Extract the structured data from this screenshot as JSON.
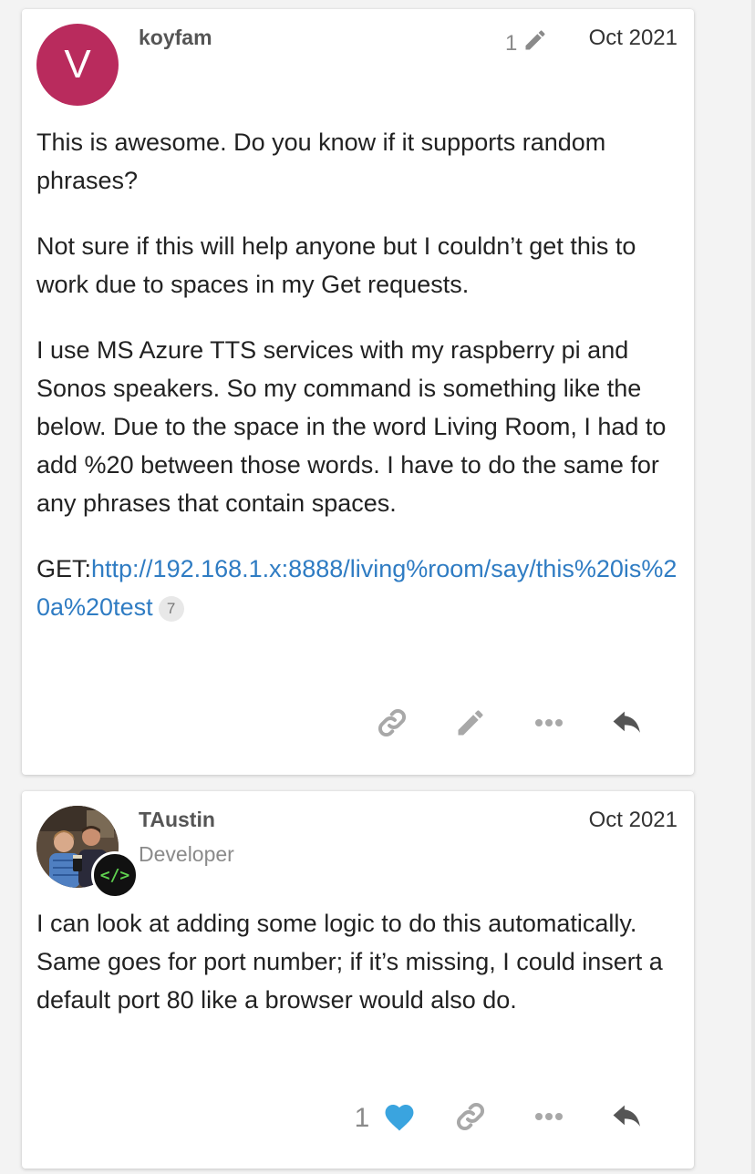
{
  "posts": [
    {
      "avatar_letter": "V",
      "avatar_color": "#b92b5d",
      "username": "koyfam",
      "edit_count": "1",
      "date": "Oct 2021",
      "paragraphs": [
        "This is awesome. Do you know if it supports random phrases?",
        "Not sure if this will help anyone but I couldn’t get this to work due to spaces in my Get requests.",
        "I use MS Azure TTS services with my raspberry pi and Sonos speakers. So my command is something like the below. Due to the space in the word Living Room, I had to add %20 between those words. I have to do the same for any phrases that contain spaces."
      ],
      "link_prefix": "GET:",
      "link_text": "http://192.168.1.x:8888/living%room/say/this%20is%20a%20test",
      "link_clicks": "7",
      "actions": [
        "link-icon",
        "pencil-icon",
        "more-icon",
        "reply-icon"
      ]
    },
    {
      "username": "TAustin",
      "user_title": "Developer",
      "badge_text": "</>",
      "date": "Oct 2021",
      "paragraphs": [
        "I can look at adding some logic to do this automatically. Same goes for port number; if it’s missing, I could insert a default port 80 like a browser would also do."
      ],
      "like_count": "1",
      "actions": [
        "heart-icon",
        "link-icon",
        "more-icon",
        "reply-icon"
      ]
    }
  ],
  "colors": {
    "link": "#2f7cc3",
    "heart": "#3aa4df",
    "icon": "#a8a8a8",
    "reply_icon": "#555555"
  }
}
